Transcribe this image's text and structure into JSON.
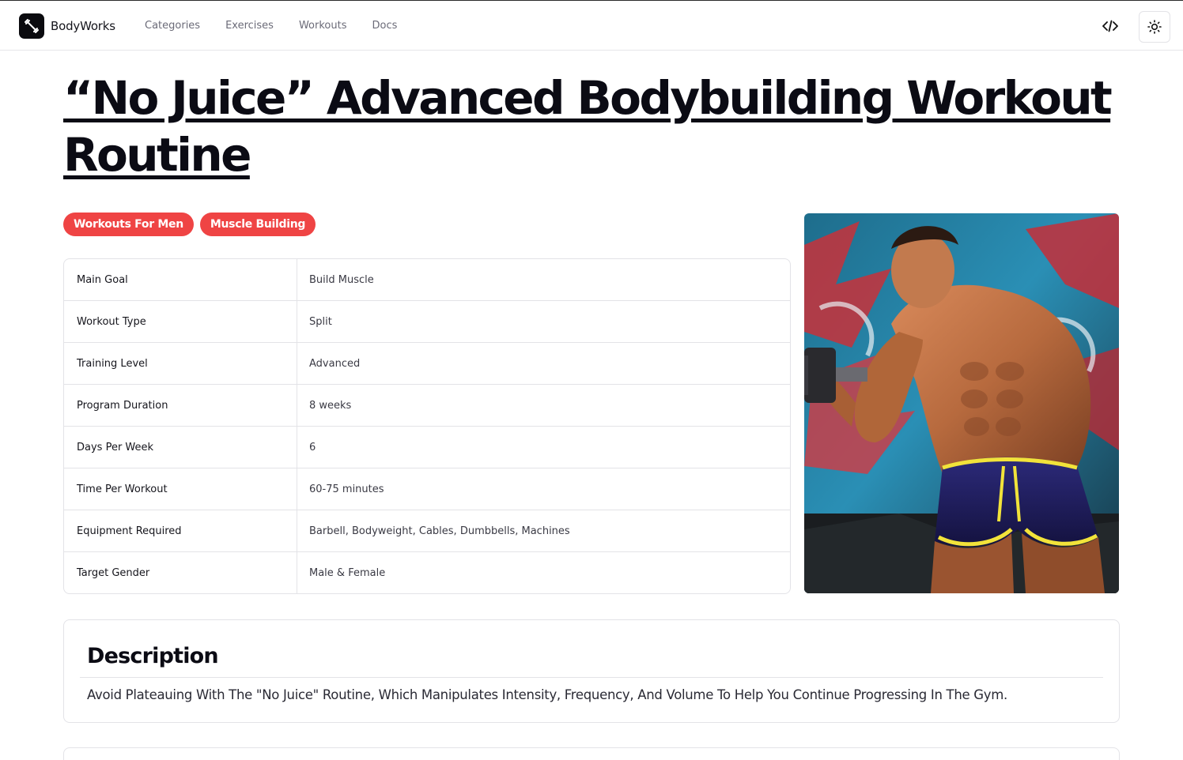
{
  "header": {
    "brand_name": "BodyWorks",
    "nav": [
      {
        "label": "Categories"
      },
      {
        "label": "Exercises"
      },
      {
        "label": "Workouts"
      },
      {
        "label": "Docs"
      }
    ],
    "code_icon": "code-icon",
    "theme_icon": "sun-icon"
  },
  "workout": {
    "title": "“No Juice” Advanced Bodybuilding Workout Routine",
    "tags": [
      "Workouts For Men",
      "Muscle Building"
    ],
    "details": [
      {
        "label": "Main Goal",
        "value": "Build Muscle"
      },
      {
        "label": "Workout Type",
        "value": "Split"
      },
      {
        "label": "Training Level",
        "value": "Advanced"
      },
      {
        "label": "Program Duration",
        "value": "8 weeks"
      },
      {
        "label": "Days Per Week",
        "value": "6"
      },
      {
        "label": "Time Per Workout",
        "value": "60-75 minutes"
      },
      {
        "label": "Equipment Required",
        "value": "Barbell, Bodyweight, Cables, Dumbbells, Machines"
      },
      {
        "label": "Target Gender",
        "value": "Male & Female"
      }
    ]
  },
  "description": {
    "title": "Description",
    "text": "Avoid Plateauing With The \"No Juice\" Routine, Which Manipulates Intensity, Frequency, And Volume To Help You Continue Progressing In The Gym."
  },
  "colors": {
    "tag_bg": "#ef4444",
    "text": "#0b0b14",
    "border": "#e3e3e7"
  }
}
